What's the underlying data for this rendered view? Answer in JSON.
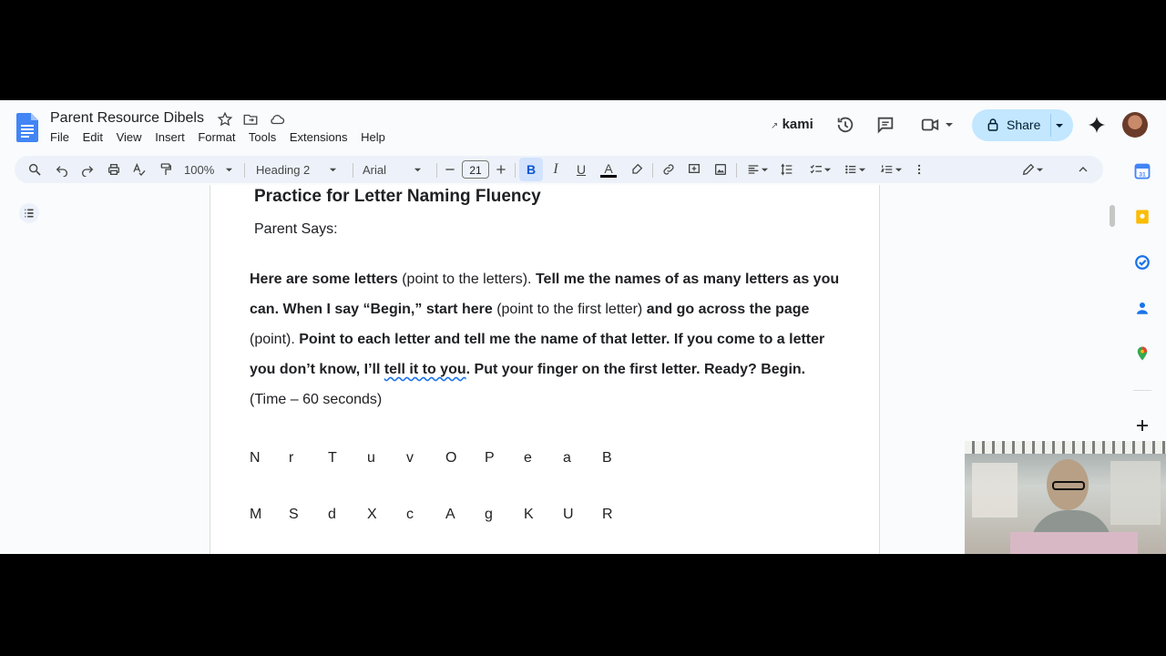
{
  "document": {
    "title": "Parent Resource Dibels",
    "menu": [
      "File",
      "Edit",
      "View",
      "Insert",
      "Format",
      "Tools",
      "Extensions",
      "Help"
    ]
  },
  "topbar": {
    "kami_label": "kami",
    "share_label": "Share"
  },
  "toolbar": {
    "zoom": "100%",
    "style": "Heading 2",
    "font": "Arial",
    "font_size": "21",
    "bold": "B",
    "italic": "I",
    "underline": "U",
    "text_color": "A"
  },
  "content": {
    "heading": "Practice for Letter Naming Fluency",
    "parent_says": "Parent Says:",
    "paragraph": [
      {
        "t": "Here are some letters",
        "b": true
      },
      {
        "t": " (point to the letters). ",
        "b": false
      },
      {
        "t": "Tell me the names of as many letters as you can. When I say “Begin,” start here",
        "b": true
      },
      {
        "t": " (point to the first letter) ",
        "b": false
      },
      {
        "t": "and go across the page",
        "b": true
      },
      {
        "t": " (point). ",
        "b": false
      },
      {
        "t": "Point to each letter and tell me the name of that letter. If you come to a letter you don’t know, I’ll ",
        "b": true
      },
      {
        "t": "tell it to you",
        "b": true,
        "spell": true
      },
      {
        "t": ". Put your finger on the first letter. Ready? Begin.",
        "b": true
      },
      {
        "t": " (Time – 60 seconds)",
        "b": false
      }
    ],
    "letter_rows": [
      [
        "N",
        "r",
        "T",
        "u",
        "v",
        "O",
        "P",
        "e",
        "a",
        "B"
      ],
      [
        "M",
        "S",
        "d",
        "X",
        "c",
        "A",
        "g",
        "K",
        "U",
        "R"
      ]
    ]
  },
  "colors": {
    "accent": "#0b57d0",
    "share_bg": "#c2e7ff",
    "toolbar_bg": "#edf2fa",
    "docs_blue": "#4285f4"
  }
}
